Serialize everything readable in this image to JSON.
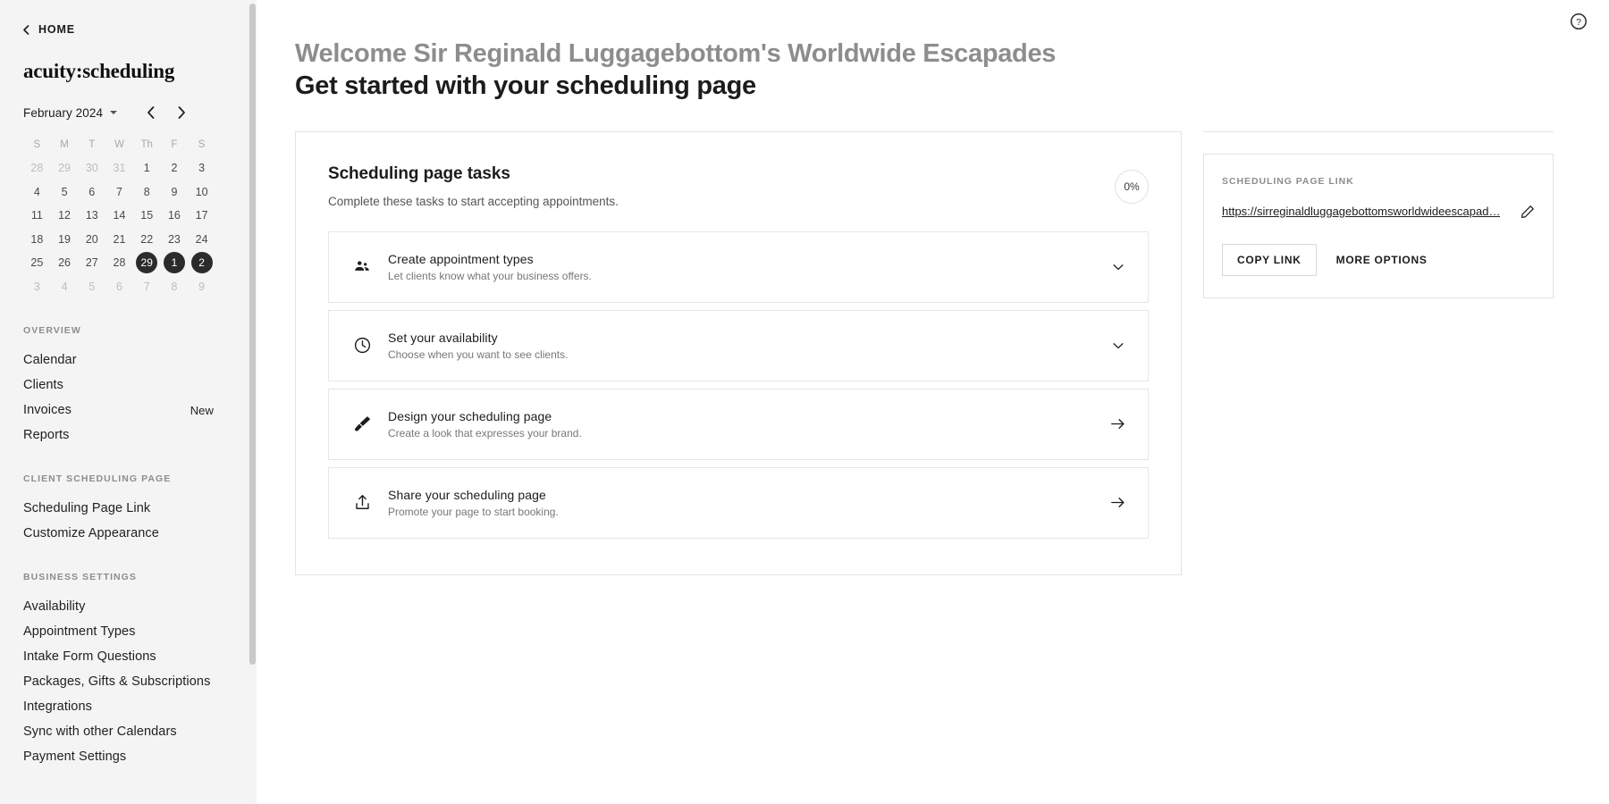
{
  "sidebar": {
    "home_label": "HOME",
    "brand": "acuity:scheduling",
    "calendar": {
      "month_label": "February 2024",
      "dow": [
        "S",
        "M",
        "T",
        "W",
        "Th",
        "F",
        "S"
      ],
      "weeks": [
        [
          {
            "d": "28",
            "m": true
          },
          {
            "d": "29",
            "m": true
          },
          {
            "d": "30",
            "m": true
          },
          {
            "d": "31",
            "m": true
          },
          {
            "d": "1",
            "m": false
          },
          {
            "d": "2",
            "m": false
          },
          {
            "d": "3",
            "m": false
          }
        ],
        [
          {
            "d": "4",
            "m": false
          },
          {
            "d": "5",
            "m": false
          },
          {
            "d": "6",
            "m": false
          },
          {
            "d": "7",
            "m": false
          },
          {
            "d": "8",
            "m": false
          },
          {
            "d": "9",
            "m": false
          },
          {
            "d": "10",
            "m": false
          }
        ],
        [
          {
            "d": "11",
            "m": false
          },
          {
            "d": "12",
            "m": false
          },
          {
            "d": "13",
            "m": false
          },
          {
            "d": "14",
            "m": false
          },
          {
            "d": "15",
            "m": false
          },
          {
            "d": "16",
            "m": false
          },
          {
            "d": "17",
            "m": false
          }
        ],
        [
          {
            "d": "18",
            "m": false
          },
          {
            "d": "19",
            "m": false
          },
          {
            "d": "20",
            "m": false
          },
          {
            "d": "21",
            "m": false
          },
          {
            "d": "22",
            "m": false
          },
          {
            "d": "23",
            "m": false
          },
          {
            "d": "24",
            "m": false
          }
        ],
        [
          {
            "d": "25",
            "m": false
          },
          {
            "d": "26",
            "m": false
          },
          {
            "d": "27",
            "m": false
          },
          {
            "d": "28",
            "m": false
          },
          {
            "d": "29",
            "m": false,
            "s": true
          },
          {
            "d": "1",
            "m": true,
            "s": true
          },
          {
            "d": "2",
            "m": true,
            "s": true
          }
        ],
        [
          {
            "d": "3",
            "m": true
          },
          {
            "d": "4",
            "m": true
          },
          {
            "d": "5",
            "m": true
          },
          {
            "d": "6",
            "m": true
          },
          {
            "d": "7",
            "m": true
          },
          {
            "d": "8",
            "m": true
          },
          {
            "d": "9",
            "m": true
          }
        ]
      ]
    },
    "sections": [
      {
        "heading": "OVERVIEW",
        "items": [
          {
            "label": "Calendar",
            "badge": ""
          },
          {
            "label": "Clients",
            "badge": ""
          },
          {
            "label": "Invoices",
            "badge": "New"
          },
          {
            "label": "Reports",
            "badge": ""
          }
        ]
      },
      {
        "heading": "CLIENT SCHEDULING PAGE",
        "items": [
          {
            "label": "Scheduling Page Link",
            "badge": ""
          },
          {
            "label": "Customize Appearance",
            "badge": ""
          }
        ]
      },
      {
        "heading": "BUSINESS SETTINGS",
        "items": [
          {
            "label": "Availability",
            "badge": ""
          },
          {
            "label": "Appointment Types",
            "badge": ""
          },
          {
            "label": "Intake Form Questions",
            "badge": ""
          },
          {
            "label": "Packages, Gifts & Subscriptions",
            "badge": ""
          },
          {
            "label": "Integrations",
            "badge": ""
          },
          {
            "label": "Sync with other Calendars",
            "badge": ""
          },
          {
            "label": "Payment Settings",
            "badge": ""
          }
        ]
      }
    ]
  },
  "header": {
    "welcome_line": "Welcome Sir Reginald Luggagebottom's Worldwide Escapades",
    "subtitle_line": "Get started with your scheduling page",
    "help_icon": "help-circle-icon"
  },
  "tasks_card": {
    "title": "Scheduling page tasks",
    "subtitle": "Complete these tasks to start accepting appointments.",
    "progress_label": "0%",
    "progress_value": 0,
    "items": [
      {
        "title": "Create appointment types",
        "desc": "Let clients know what your business offers.",
        "icon": "people-group-icon",
        "action": "chevron-down-icon"
      },
      {
        "title": "Set your availability",
        "desc": "Choose when you want to see clients.",
        "icon": "clock-icon",
        "action": "chevron-down-icon"
      },
      {
        "title": "Design your scheduling page",
        "desc": "Create a look that expresses your brand.",
        "icon": "paintbrush-icon",
        "action": "arrow-right-icon"
      },
      {
        "title": "Share your scheduling page",
        "desc": "Promote your page to start booking.",
        "icon": "share-upload-icon",
        "action": "arrow-right-icon"
      }
    ]
  },
  "link_panel": {
    "label": "SCHEDULING PAGE LINK",
    "url": "https://sirreginaldluggagebottomsworldwideescapad…",
    "edit_icon": "pencil-icon",
    "copy_label": "COPY LINK",
    "more_label": "MORE OPTIONS"
  },
  "colors": {
    "sidebar_bg": "#f4f4f4",
    "selected_day": "#2b2b2b",
    "muted_text": "#bdbdbd",
    "border": "#e3e3e3"
  }
}
